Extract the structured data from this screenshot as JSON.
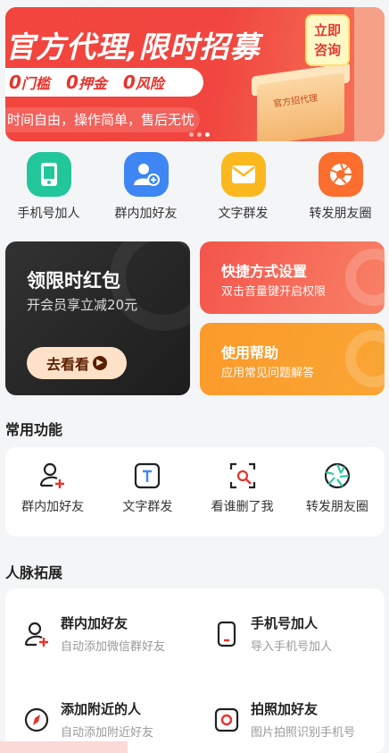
{
  "banner": {
    "title": "官方代理,限时招募",
    "badges": [
      {
        "num": "0",
        "text": "门槛"
      },
      {
        "num": "0",
        "text": "押金"
      },
      {
        "num": "0",
        "text": "风险"
      }
    ],
    "subtitle": "时间自由，操作简单，售后无忧",
    "consult_line1": "立即",
    "consult_line2": "咨询",
    "box_label": "官方招代理"
  },
  "quick": [
    {
      "label": "手机号加人",
      "icon": "phone-icon",
      "color": "#21c79a"
    },
    {
      "label": "群内加好友",
      "icon": "user-add-icon",
      "color": "#3d86f4"
    },
    {
      "label": "文字群发",
      "icon": "mail-icon",
      "color": "#fbb81e"
    },
    {
      "label": "转发朋友圈",
      "icon": "aperture-icon",
      "color": "#fb6e2e"
    }
  ],
  "promo": {
    "dark_title": "领限时红包",
    "dark_sub": "开会员享立减20元",
    "dark_button": "去看看",
    "red_title": "快捷方式设置",
    "red_sub": "双击音量键开启权限",
    "orange_title": "使用帮助",
    "orange_sub": "应用常见问题解答"
  },
  "common": {
    "title": "常用功能",
    "items": [
      {
        "label": "群内加好友",
        "icon": "user-add-icon"
      },
      {
        "label": "文字群发",
        "icon": "text-icon"
      },
      {
        "label": "看谁删了我",
        "icon": "scan-search-icon"
      },
      {
        "label": "转发朋友圈",
        "icon": "aperture-icon"
      }
    ]
  },
  "network": {
    "title": "人脉拓展",
    "items": [
      {
        "title": "群内加好友",
        "sub": "自动添加微信群好友",
        "icon": "user-add-icon"
      },
      {
        "title": "手机号加人",
        "sub": "导入手机号加人",
        "icon": "phone-icon"
      },
      {
        "title": "添加附近的人",
        "sub": "自动添加附近好友",
        "icon": "compass-icon"
      },
      {
        "title": "拍照加好友",
        "sub": "图片拍照识别手机号",
        "icon": "camera-icon"
      }
    ]
  },
  "colors": {
    "accent_red": "#e8332c",
    "accent_orange": "#fb9a2b"
  }
}
